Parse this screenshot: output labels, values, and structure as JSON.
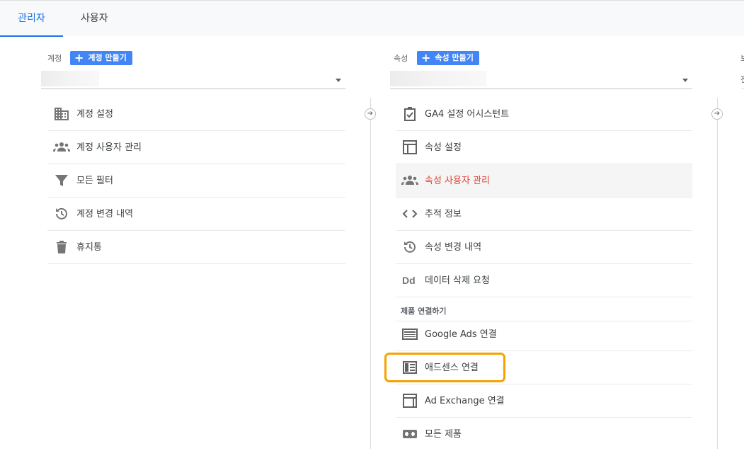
{
  "tabs": [
    {
      "label": "관리자",
      "active": true
    },
    {
      "label": "사용자",
      "active": false
    }
  ],
  "account_column": {
    "label": "계정",
    "create_button": "계정 만들기",
    "items": [
      {
        "icon": "building-icon",
        "label": "계정 설정"
      },
      {
        "icon": "people-icon",
        "label": "계정 사용자 관리"
      },
      {
        "icon": "filter-icon",
        "label": "모든 필터"
      },
      {
        "icon": "history-icon",
        "label": "계정 변경 내역"
      },
      {
        "icon": "trash-icon",
        "label": "휴지통"
      }
    ]
  },
  "property_column": {
    "label": "속성",
    "create_button": "속성 만들기",
    "items": [
      {
        "icon": "clipboard-check-icon",
        "label": "GA4 설정 어시스턴트"
      },
      {
        "icon": "layout-icon",
        "label": "속성 설정"
      },
      {
        "icon": "people-icon",
        "label": "속성 사용자 관리",
        "active": true
      },
      {
        "icon": "code-icon",
        "label": "추적 정보"
      },
      {
        "icon": "history-icon",
        "label": "속성 변경 내역"
      },
      {
        "icon": "dd-icon",
        "label": "데이터 삭제 요청"
      }
    ],
    "product_linking": {
      "header": "제품 연결하기",
      "items": [
        {
          "icon": "ads-icon",
          "label": "Google Ads 연결"
        },
        {
          "icon": "adsense-icon",
          "label": "애드센스 연결",
          "highlighted": true
        },
        {
          "icon": "adexchange-icon",
          "label": "Ad Exchange 연결"
        },
        {
          "icon": "link-icon",
          "label": "모든 제품"
        }
      ]
    }
  },
  "view_column": {
    "label_partial": "보",
    "value_partial": "전"
  },
  "colors": {
    "accent": "#1a73e8",
    "button": "#4285f4",
    "active_text": "#e2463a",
    "highlight": "#f4a300"
  }
}
